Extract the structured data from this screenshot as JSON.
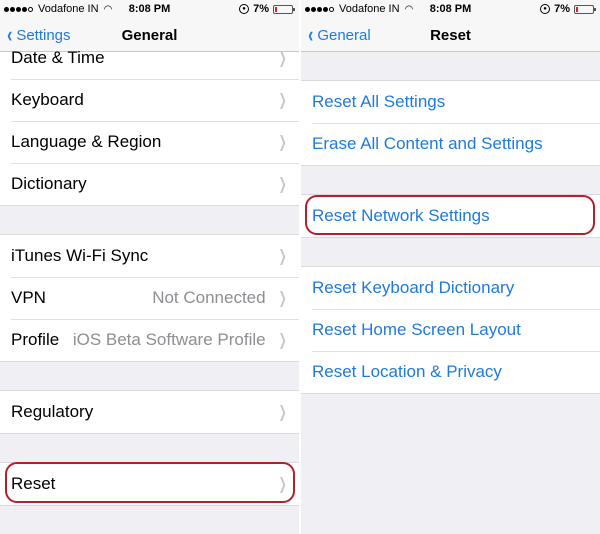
{
  "status_bar": {
    "signal_bars_filled": 4,
    "signal_bars_total": 5,
    "carrier": "Vodafone IN",
    "wifi_icon": "wifi-icon",
    "time": "8:08 PM",
    "orientation_lock_icon": "orientation-lock-icon",
    "battery_percent": "7%",
    "battery_level": 0.07,
    "battery_color": "#e02020"
  },
  "accent_color": "#1f7ae0",
  "highlight_color": "#b4202a",
  "left_screen": {
    "back_label": "Settings",
    "title": "General",
    "groups": [
      {
        "items": [
          {
            "label": "Date & Time",
            "value": ""
          },
          {
            "label": "Keyboard",
            "value": ""
          },
          {
            "label": "Language & Region",
            "value": ""
          },
          {
            "label": "Dictionary",
            "value": ""
          }
        ]
      },
      {
        "items": [
          {
            "label": "iTunes Wi-Fi Sync",
            "value": ""
          },
          {
            "label": "VPN",
            "value": "Not Connected"
          },
          {
            "label": "Profile",
            "value": "iOS Beta Software Profile"
          }
        ]
      },
      {
        "items": [
          {
            "label": "Regulatory",
            "value": ""
          }
        ]
      },
      {
        "items": [
          {
            "label": "Reset",
            "value": "",
            "highlighted": true
          }
        ]
      }
    ]
  },
  "right_screen": {
    "back_label": "General",
    "title": "Reset",
    "groups": [
      {
        "items": [
          {
            "label": "Reset All Settings"
          },
          {
            "label": "Erase All Content and Settings"
          }
        ]
      },
      {
        "items": [
          {
            "label": "Reset Network Settings",
            "highlighted": true
          }
        ]
      },
      {
        "items": [
          {
            "label": "Reset Keyboard Dictionary"
          },
          {
            "label": "Reset Home Screen Layout"
          },
          {
            "label": "Reset Location & Privacy"
          }
        ]
      }
    ]
  }
}
